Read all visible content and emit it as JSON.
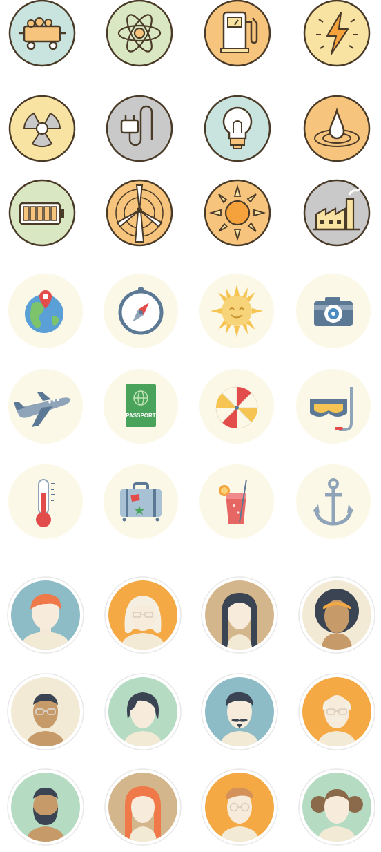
{
  "energy_icons": [
    {
      "icon": "mine-cart-icon"
    },
    {
      "icon": "atom-icon"
    },
    {
      "icon": "fuel-pump-icon"
    },
    {
      "icon": "lightning-icon"
    },
    {
      "icon": "radiation-icon"
    },
    {
      "icon": "plug-icon"
    },
    {
      "icon": "light-bulb-icon"
    },
    {
      "icon": "water-drop-icon"
    },
    {
      "icon": "battery-icon"
    },
    {
      "icon": "wind-turbine-icon"
    },
    {
      "icon": "sun-icon"
    },
    {
      "icon": "factory-icon"
    }
  ],
  "travel_icons": [
    {
      "icon": "globe-pin-icon"
    },
    {
      "icon": "compass-icon"
    },
    {
      "icon": "smiling-sun-icon"
    },
    {
      "icon": "camera-icon"
    },
    {
      "icon": "airplane-icon"
    },
    {
      "icon": "passport-icon",
      "label": "PASSPORT"
    },
    {
      "icon": "beach-umbrella-icon"
    },
    {
      "icon": "snorkel-mask-icon"
    },
    {
      "icon": "thermometer-icon"
    },
    {
      "icon": "suitcase-icon"
    },
    {
      "icon": "cocktail-icon"
    },
    {
      "icon": "anchor-icon"
    }
  ],
  "avatar_icons": [
    {
      "icon": "avatar-red-hair-man-icon"
    },
    {
      "icon": "avatar-white-hair-woman-glasses-icon"
    },
    {
      "icon": "avatar-long-hair-woman-icon"
    },
    {
      "icon": "avatar-headband-woman-icon"
    },
    {
      "icon": "avatar-man-glasses-icon"
    },
    {
      "icon": "avatar-bob-hair-woman-icon"
    },
    {
      "icon": "avatar-mustache-man-icon"
    },
    {
      "icon": "avatar-old-man-glasses-icon"
    },
    {
      "icon": "avatar-bearded-man-icon"
    },
    {
      "icon": "avatar-red-hair-woman-icon"
    },
    {
      "icon": "avatar-round-glasses-man-icon"
    },
    {
      "icon": "avatar-bun-hair-woman-icon"
    }
  ],
  "colors": {
    "energy_blue": "#c9e3df",
    "energy_green": "#d9e7c2",
    "energy_orange": "#f6c47c",
    "energy_yellow": "#f8e3a3",
    "energy_gray": "#c9c9c9",
    "energy_outline": "#4a3a28",
    "travel_bg": "#fcf8e8",
    "avatar_blue": "#8dbcc6",
    "avatar_orange": "#f4a944",
    "avatar_tan": "#d4b68c",
    "avatar_cream": "#f3ead5",
    "avatar_green": "#b5dcc3"
  }
}
